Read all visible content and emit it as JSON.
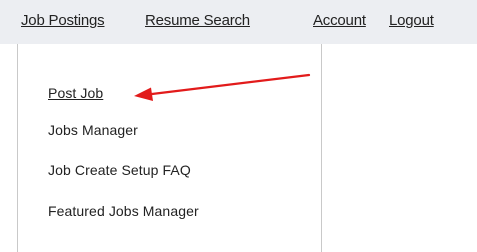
{
  "nav": {
    "items": [
      {
        "label": "Job Postings"
      },
      {
        "label": "Resume Search"
      },
      {
        "label": "Account"
      },
      {
        "label": "Logout"
      }
    ]
  },
  "dropdown": {
    "items": [
      {
        "label": "Post Job"
      },
      {
        "label": "Jobs Manager"
      },
      {
        "label": "Job Create Setup FAQ"
      },
      {
        "label": "Featured Jobs Manager"
      }
    ]
  },
  "annotation": {
    "arrow_color": "#e21b1b"
  }
}
